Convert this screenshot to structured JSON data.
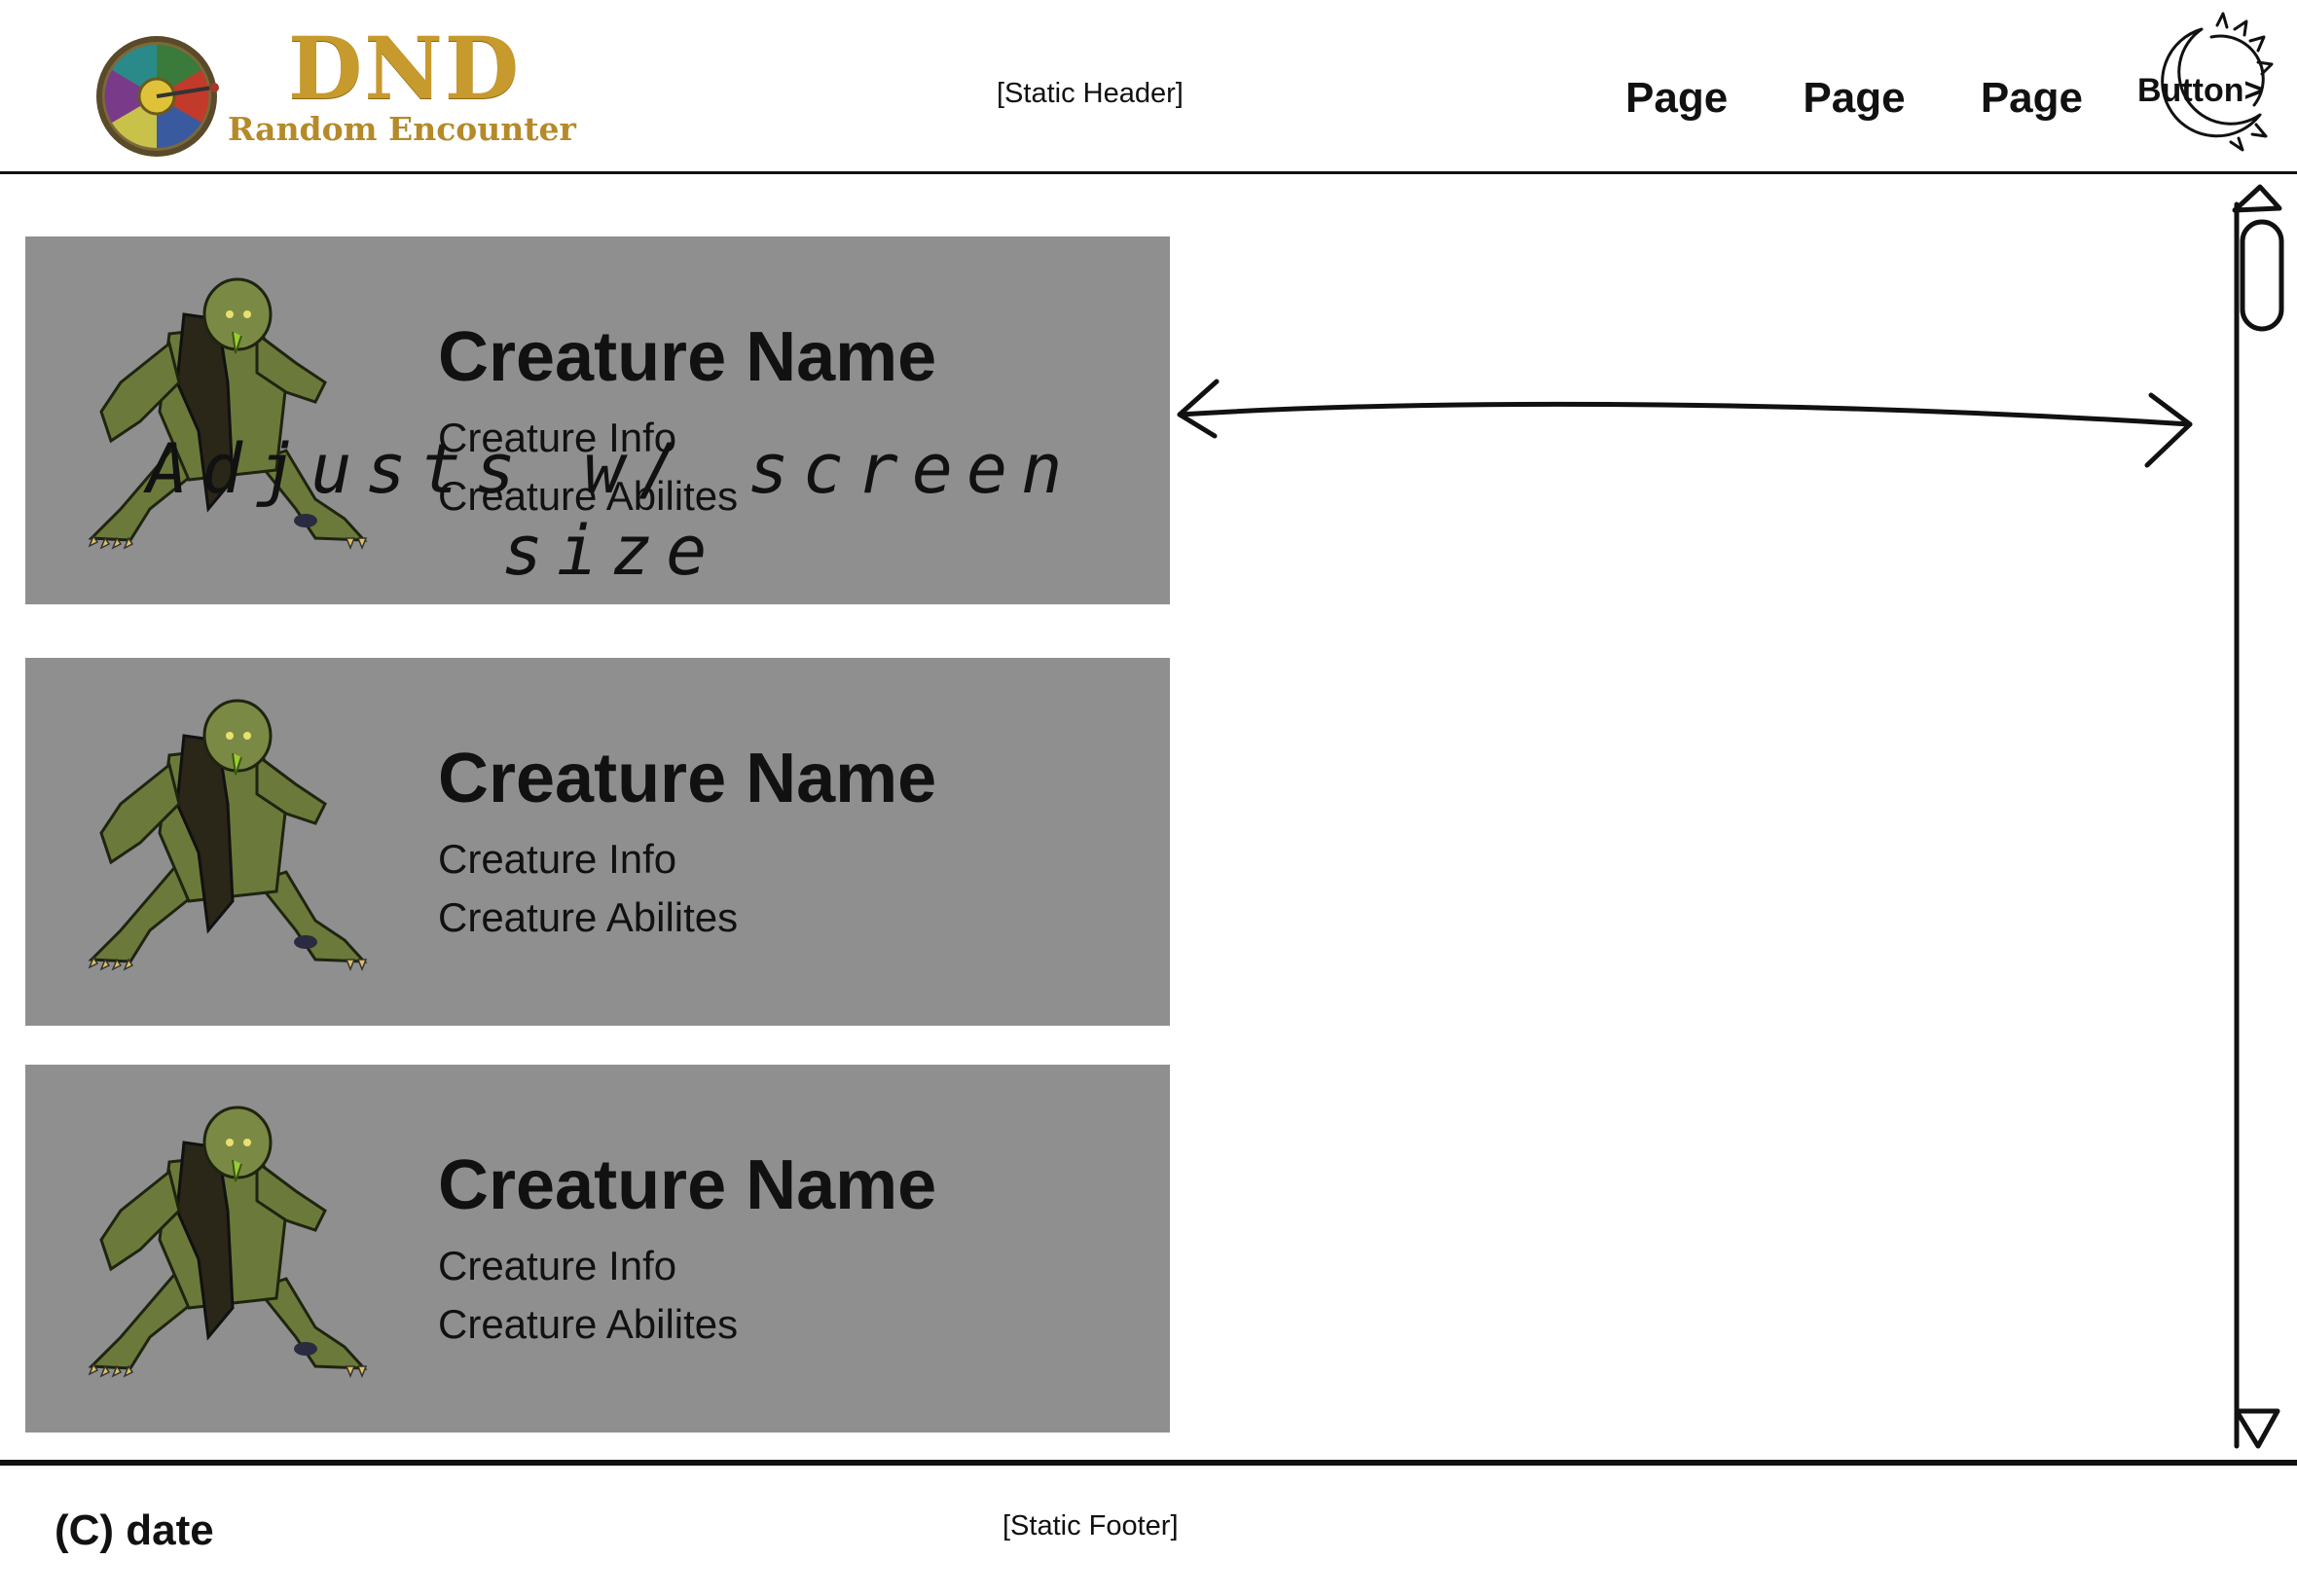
{
  "header": {
    "logo": {
      "title": "DND",
      "subtitle": "Random Encounter"
    },
    "static_label": "[Static Header]",
    "nav": [
      {
        "label": "Page"
      },
      {
        "label": "Page"
      },
      {
        "label": "Page"
      }
    ],
    "button_label": "Button>"
  },
  "cards": [
    {
      "name": "Creature Name",
      "info": "Creature Info",
      "abilities": "Creature Abilites"
    },
    {
      "name": "Creature Name",
      "info": "Creature Info",
      "abilities": "Creature Abilites"
    },
    {
      "name": "Creature Name",
      "info": "Creature Info",
      "abilities": "Creature Abilites"
    }
  ],
  "annotation": {
    "text": "Adjusts w/ screen size"
  },
  "footer": {
    "copyright": "(C) date",
    "static_label": "[Static Footer]"
  },
  "colors": {
    "card_bg": "#8f8f8f",
    "logo_gold": "#c79a2e",
    "creature_green": "#6b7a3a"
  },
  "icons": {
    "logo": "dice-wheel-icon",
    "button": "sun-moon-icon",
    "creature": "zombie-creature-image"
  }
}
